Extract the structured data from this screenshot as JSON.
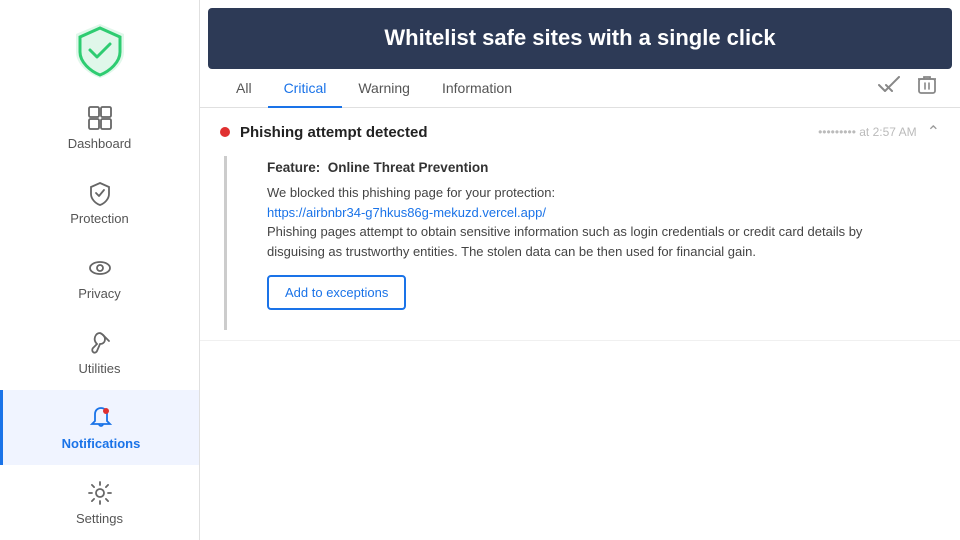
{
  "tooltip": {
    "text": "Whitelist safe sites with a single click"
  },
  "sidebar": {
    "items": [
      {
        "id": "dashboard",
        "label": "Dashboard",
        "icon": "dashboard-icon",
        "active": false
      },
      {
        "id": "protection",
        "label": "Protection",
        "icon": "shield-icon",
        "active": false
      },
      {
        "id": "privacy",
        "label": "Privacy",
        "icon": "eye-icon",
        "active": false
      },
      {
        "id": "utilities",
        "label": "Utilities",
        "icon": "utilities-icon",
        "active": false
      },
      {
        "id": "notifications",
        "label": "Notifications",
        "icon": "bell-icon",
        "active": true
      },
      {
        "id": "settings",
        "label": "Settings",
        "icon": "gear-icon",
        "active": false
      }
    ]
  },
  "main": {
    "tabs": [
      {
        "id": "all",
        "label": "All",
        "active": false
      },
      {
        "id": "critical",
        "label": "Critical",
        "active": true
      },
      {
        "id": "warning",
        "label": "Warning",
        "active": false
      },
      {
        "id": "information",
        "label": "Information",
        "active": false
      }
    ],
    "notifications": [
      {
        "id": "phishing-1",
        "dot_color": "#e03030",
        "title": "Phishing attempt detected",
        "source": "••••••••• at 2:57 AM",
        "feature_label": "Feature:",
        "feature_value": "Online Threat Prevention",
        "description": "We blocked this phishing page for your protection:\nhttps://airbnbr34-g7hkus86g-mekuzd.vercel.app/\nPhishing pages attempt to obtain sensitive information such as login credentials or credit card details by disguising as trustworthy entities. The stolen data can be then used for financial gain.",
        "button_label": "Add to exceptions",
        "expanded": true
      }
    ]
  },
  "brand": {
    "logo_color": "#2ecc71",
    "accent_color": "#1a73e8"
  }
}
